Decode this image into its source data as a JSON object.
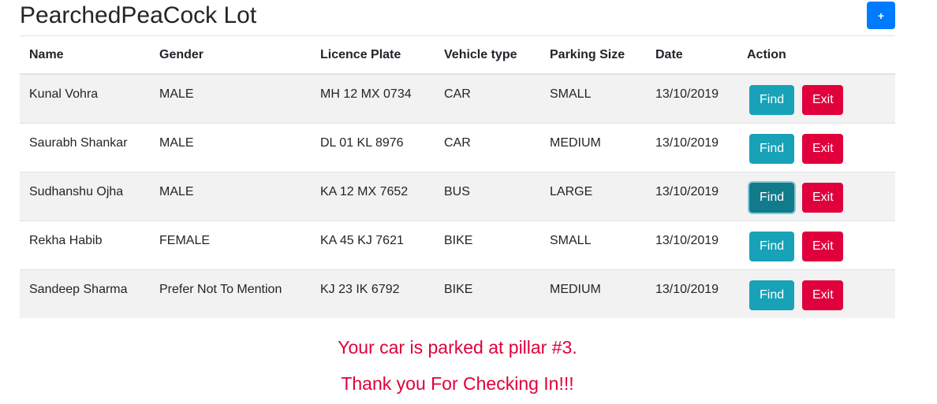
{
  "header": {
    "title": "PearchedPeaCock Lot",
    "add_label": "+"
  },
  "table": {
    "columns": [
      "Name",
      "Gender",
      "Licence Plate",
      "Vehicle type",
      "Parking Size",
      "Date",
      "Action"
    ],
    "rows": [
      [
        "Kunal Vohra",
        "MALE",
        "MH 12 MX 0734",
        "CAR",
        "SMALL",
        "13/10/2019"
      ],
      [
        "Saurabh Shankar",
        "MALE",
        "DL 01 KL 8976",
        "CAR",
        "MEDIUM",
        "13/10/2019"
      ],
      [
        "Sudhanshu Ojha",
        "MALE",
        "KA 12 MX 7652",
        "BUS",
        "LARGE",
        "13/10/2019"
      ],
      [
        "Rekha Habib",
        "FEMALE",
        "KA 45 KJ 7621",
        "BIKE",
        "SMALL",
        "13/10/2019"
      ],
      [
        "Sandeep Sharma",
        "Prefer Not To Mention",
        "KJ 23 IK 6792",
        "BIKE",
        "MEDIUM",
        "13/10/2019"
      ]
    ],
    "find_label": "Find",
    "exit_label": "Exit",
    "active_find_row": 2
  },
  "messages": {
    "location": "Your car is parked at pillar #3.",
    "thanks": "Thank you For Checking In!!!"
  },
  "colors": {
    "primary": "#007bff",
    "info": "#17a2b8",
    "danger": "#e0003c"
  }
}
